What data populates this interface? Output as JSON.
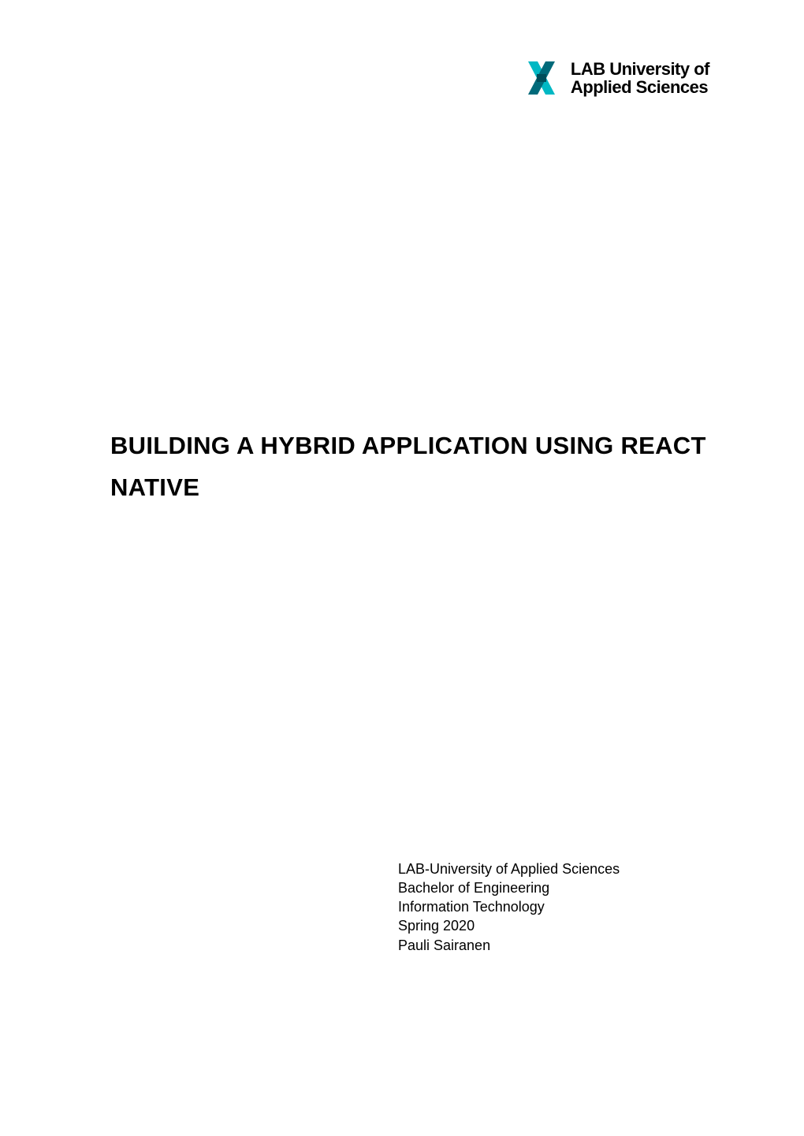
{
  "logo": {
    "text_line1": "LAB University of",
    "text_line2": "Applied Sciences"
  },
  "title": "BUILDING A HYBRID APPLICATION USING REACT NATIVE",
  "footer": {
    "institution": "LAB-University of Applied Sciences",
    "degree": "Bachelor of Engineering",
    "program": "Information Technology",
    "term": "Spring 2020",
    "author": "Pauli Sairanen"
  }
}
